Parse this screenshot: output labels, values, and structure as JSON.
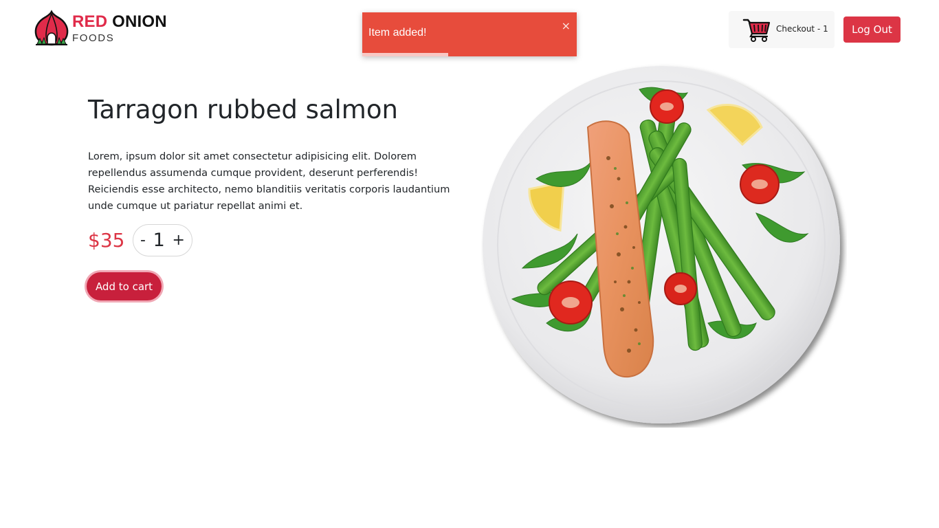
{
  "brand": {
    "name_red": "RED",
    "name_dark": "ONION",
    "sub": "FOODS"
  },
  "toast": {
    "message": "Item added!",
    "close": "×",
    "progress": 0.4
  },
  "header": {
    "checkout_label": "Checkout - 1",
    "logout_label": "Log Out"
  },
  "product": {
    "title": "Tarragon rubbed salmon",
    "description": "Lorem, ipsum dolor sit amet consectetur adipisicing elit. Dolorem repellendus assumenda cumque provident, deserunt perferendis! Reiciendis esse architecto, nemo blanditiis veritatis corporis laudantium unde cumque ut pariatur repellat animi et.",
    "price": "$35",
    "quantity": "1",
    "decrement": "-",
    "increment": "+",
    "add_to_cart": "Add to cart"
  },
  "colors": {
    "brand_red": "#e02b4a",
    "toast": "#e74c3c",
    "button_red": "#dc3545",
    "add_cart": "#c8203c"
  }
}
